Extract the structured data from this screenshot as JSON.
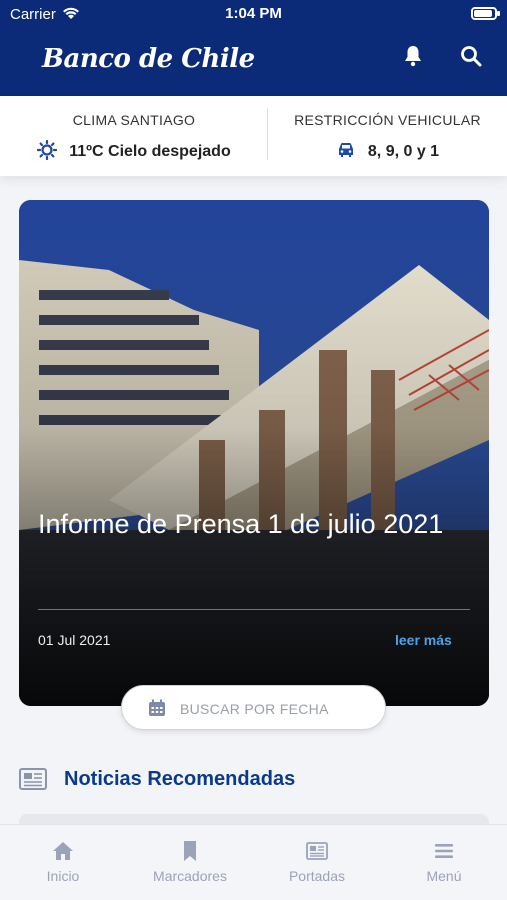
{
  "status_bar": {
    "carrier": "Carrier",
    "time": "1:04 PM"
  },
  "header": {
    "logo": "Banco de Chile",
    "icons": [
      "bell-icon",
      "search-icon"
    ]
  },
  "info": {
    "weather_title": "CLIMA SANTIAGO",
    "weather_value": "11ºC Cielo despejado",
    "restriction_title": "RESTRICCIÓN VEHICULAR",
    "restriction_value": "8, 9, 0 y 1"
  },
  "hero": {
    "title": "Informe de Prensa 1 de julio 2021",
    "date": "01 Jul 2021",
    "more": "leer más"
  },
  "date_search": {
    "label": "BUSCAR POR FECHA"
  },
  "recommended": {
    "title": "Noticias Recomendadas"
  },
  "tabs": [
    {
      "label": "Inicio",
      "icon": "home-icon"
    },
    {
      "label": "Marcadores",
      "icon": "bookmark-icon"
    },
    {
      "label": "Portadas",
      "icon": "newspaper-icon"
    },
    {
      "label": "Menú",
      "icon": "menu-icon"
    }
  ],
  "colors": {
    "header": "#0b2a78",
    "accent": "#0b3a8c",
    "link": "#4aa3e8"
  }
}
